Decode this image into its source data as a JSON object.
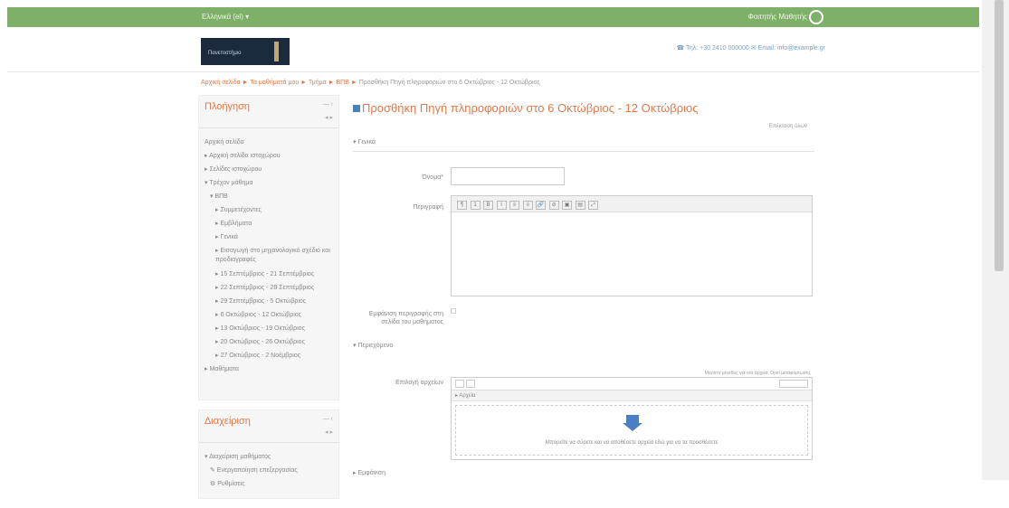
{
  "topbar": {
    "site_link": "Ελληνικά (el) ▾",
    "user_name": "Φοιτητής Μαθητής"
  },
  "header": {
    "logo_text": "Πανεπιστήμιο",
    "contact": "☎ Τηλ: +30 2410 000000 ✉ Email: info@example.gr"
  },
  "breadcrumb": {
    "path": "Αρχική σελίδα ► Τα μαθήματά μου ► Τμήμα ► ΒΠΒ ► ",
    "current": "Προσθήκη Πηγή πληροφοριών στο 6 Οκτώβριος - 12 Οκτώβριος"
  },
  "nav_block": {
    "title": "Πλοήγηση",
    "controls": "— ‹",
    "controls2": "◂ ▸",
    "items": [
      "Αρχική σελίδα",
      "▸ Αρχική σελίδα ιστοχώρου",
      "▸ Σελίδες ιστοχώρου",
      "▾ Τρέχον μάθημα",
      "▾ ΒΠΒ",
      "▸ Συμμετέχοντες",
      "▸ Εμβλήματα",
      "▸ Γενικά",
      "▸ Εισαγωγή στο μηχανολογικό σχέδιο και προδιαγραφές",
      "▸ 15 Σεπτέμβριος - 21 Σεπτέμβριος",
      "▸ 22 Σεπτέμβριος - 28 Σεπτέμβριος",
      "▸ 29 Σεπτέμβριος - 5 Οκτώβριος",
      "▸ 6 Οκτώβριος - 12 Οκτώβριος",
      "▸ 13 Οκτώβριος - 19 Οκτώβριος",
      "▸ 20 Οκτώβριος - 26 Οκτώβριος",
      "▸ 27 Οκτώβριος - 2 Νοέμβριος",
      "▸ Μαθήματα"
    ]
  },
  "admin_block": {
    "title": "Διαχείριση",
    "controls": "— ‹",
    "controls2": "◂ ▸",
    "items": [
      "▾ Διαχείριση μαθήματος",
      "✎ Ενεργοποίηση επεξεργασίας",
      "⚙ Ρυθμίσεις"
    ]
  },
  "page": {
    "title": "Προσθήκη Πηγή πληροφοριών στο 6 Οκτώβριος - 12 Οκτώβριος",
    "expand_all": "Επέκταση όλων",
    "section_general": "▾ Γενικά",
    "name_label": "Όνομα*",
    "description_label": "Περιγραφή",
    "show_desc_label": "Εμφάνιση περιγραφής στη σελίδα του μαθήματος",
    "section_content": "▾ Περιεχόμενο",
    "select_files_label": "Επιλογή αρχείων",
    "max_size": "Μέγιστο μέγεθος για νέα αρχεία: Όριο μεταφόρτωσης",
    "files_path": "▸ Αρχεία",
    "drop_hint": "Μπορείτε να σύρετε και να αποθέσετε αρχεία εδώ για να τα προσθέσετε",
    "section_appearance": "▸ Εμφάνιση"
  },
  "editor_buttons": [
    "¶",
    "1",
    "B",
    "I",
    "≡",
    "≡",
    "🔗",
    "⊘",
    "▣",
    "▤",
    "⤢"
  ]
}
